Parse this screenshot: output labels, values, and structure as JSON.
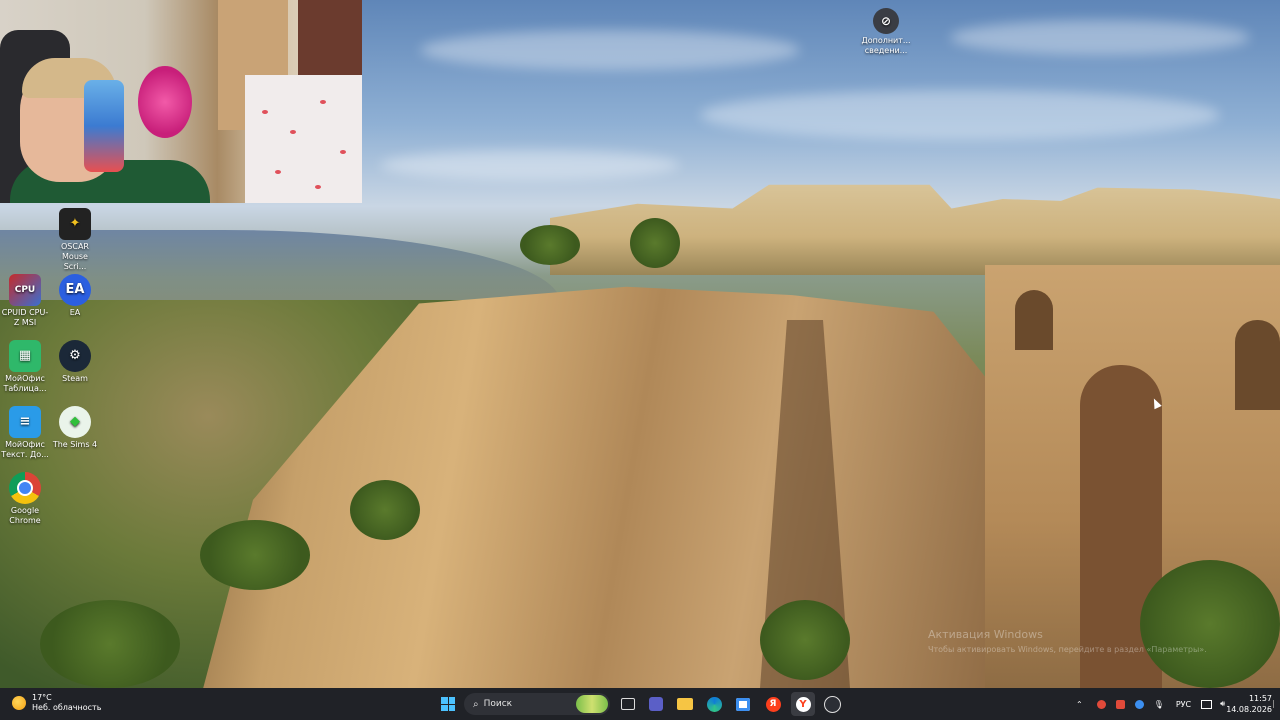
{
  "webcam": {
    "description_name": "webcam-overlay"
  },
  "desktop_icons": [
    {
      "label": "OSCAR Mouse Scri...",
      "icon": "oscar-icon"
    },
    {
      "label": "CPUID CPU-Z MSI",
      "icon": "cpuz-icon"
    },
    {
      "label": "EA",
      "icon": "ea-icon"
    },
    {
      "label": "МойОфис Таблица...",
      "icon": "myoffice-table-icon"
    },
    {
      "label": "Steam",
      "icon": "steam-icon"
    },
    {
      "label": "МойОфис Текст. До...",
      "icon": "myoffice-text-icon"
    },
    {
      "label": "The Sims 4",
      "icon": "sims4-icon"
    },
    {
      "label": "Google Chrome",
      "icon": "chrome-icon"
    },
    {
      "label": "Дополнит... сведени...",
      "icon": "info-icon"
    }
  ],
  "watermark": {
    "line1": "Активация Windows",
    "line2": "Чтобы активировать Windows, перейдите в раздел «Параметры»."
  },
  "taskbar": {
    "weather": {
      "temp": "17°C",
      "condition": "Неб. облачность"
    },
    "search_placeholder": "Поиск",
    "apps": [
      "windows-start-icon",
      "task-view-icon",
      "teams-icon",
      "file-explorer-icon",
      "edge-icon",
      "store-icon",
      "yandex-icon",
      "yandex-browser-icon",
      "steam-taskbar-icon"
    ],
    "tray": {
      "language": "РУС"
    },
    "clock": {
      "time": "11:57",
      "date": "14.08.2026"
    }
  },
  "colors": {
    "taskbar_bg": "#202227",
    "accent": "#3c8ff0"
  }
}
